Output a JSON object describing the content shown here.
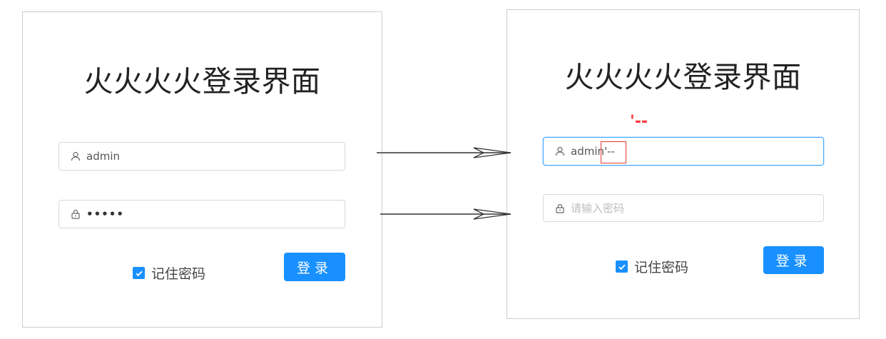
{
  "left_form": {
    "title": "火火火火登录界面",
    "username_value": "admin",
    "password_value": "•••••",
    "remember_label": "记住密码",
    "login_label": "登录"
  },
  "right_form": {
    "title": "火火火火登录界面",
    "injection_label": "'--",
    "username_value": "admin'--",
    "password_placeholder": "请输入密码",
    "remember_label": "记住密码",
    "login_label": "登录"
  },
  "colors": {
    "primary": "#1890ff",
    "focus_border": "#40a9ff",
    "injection": "#ff3b3b"
  },
  "icons": [
    "user-icon",
    "lock-icon",
    "check-icon",
    "arrow-icon"
  ]
}
